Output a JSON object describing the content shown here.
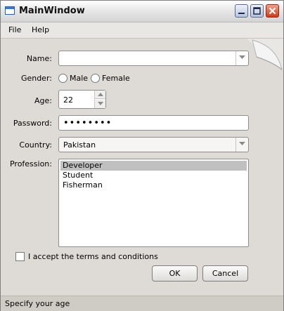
{
  "window": {
    "title": "MainWindow"
  },
  "menu": {
    "items": [
      "File",
      "Help"
    ]
  },
  "form": {
    "name": {
      "label": "Name:",
      "value": ""
    },
    "gender": {
      "label": "Gender:",
      "options": [
        "Male",
        "Female"
      ],
      "selected": null
    },
    "age": {
      "label": "Age:",
      "value": "22"
    },
    "password": {
      "label": "Password:",
      "value": "••••••••"
    },
    "country": {
      "label": "Country:",
      "value": "Pakistan"
    },
    "profession": {
      "label": "Profession:",
      "items": [
        "Developer",
        "Student",
        "Fisherman"
      ],
      "selected": "Developer"
    },
    "terms": {
      "label": "I accept the terms and conditions",
      "checked": false
    }
  },
  "buttons": {
    "ok": "OK",
    "cancel": "Cancel"
  },
  "status": {
    "text": "Specify your age"
  }
}
